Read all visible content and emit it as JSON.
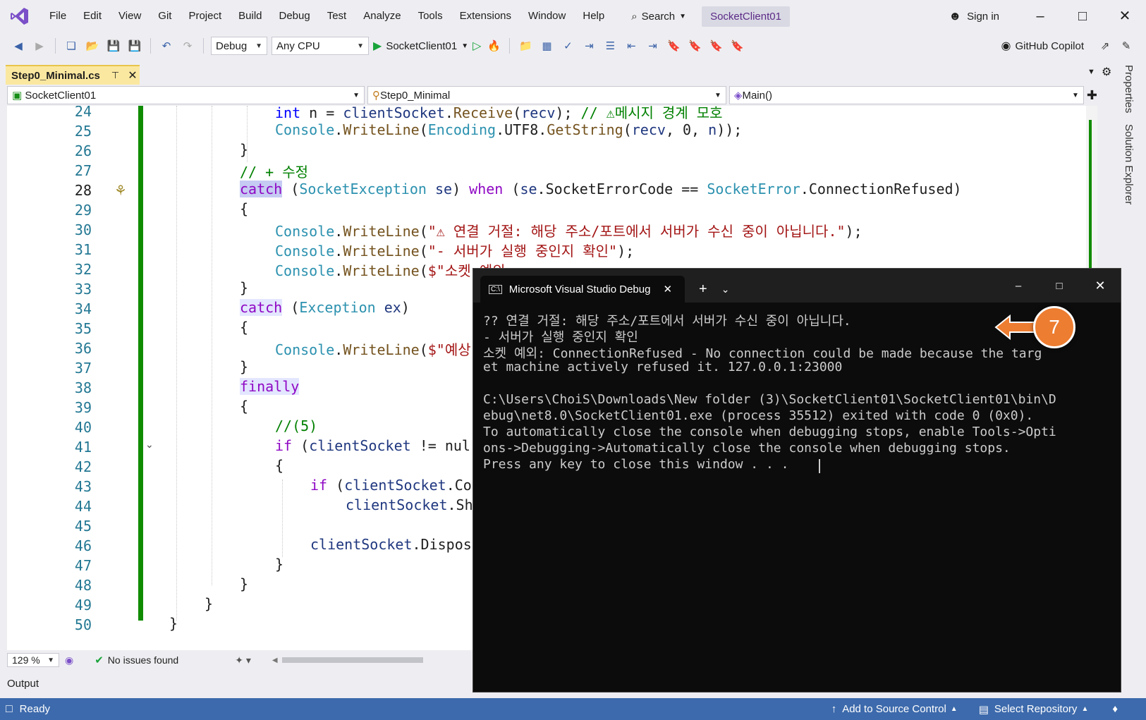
{
  "titlebar": {
    "menu": [
      "File",
      "Edit",
      "View",
      "Git",
      "Project",
      "Build",
      "Debug",
      "Test",
      "Analyze",
      "Tools",
      "Extensions",
      "Window",
      "Help"
    ],
    "search_label": "Search",
    "solution_name": "SocketClient01",
    "sign_in": "Sign in"
  },
  "toolbar": {
    "config": "Debug",
    "platform": "Any CPU",
    "run_target": "SocketClient01",
    "copilot": "GitHub Copilot"
  },
  "doc_tab": {
    "title": "Step0_Minimal.cs"
  },
  "navbar": {
    "project": "SocketClient01",
    "class": "Step0_Minimal",
    "member": "Main()"
  },
  "editor": {
    "line_numbers": [
      "24",
      "25",
      "26",
      "27",
      "28",
      "29",
      "30",
      "31",
      "32",
      "33",
      "34",
      "35",
      "36",
      "37",
      "38",
      "39",
      "40",
      "41",
      "42",
      "43",
      "44",
      "45",
      "46",
      "47",
      "48",
      "49",
      "50"
    ],
    "active_line": "28",
    "code": {
      "l24": [
        "int",
        " n = ",
        "clientSocket",
        ".",
        "Receive",
        "(",
        "recv",
        "); ",
        "// ⚠메시지 경계 모호"
      ],
      "l25": [
        "Console",
        ".",
        "WriteLine",
        "(",
        "Encoding",
        ".UTF8.",
        "GetString",
        "(",
        "recv",
        ", 0, ",
        "n",
        "));"
      ],
      "l26": "}",
      "l27": "// + 수정",
      "l28": [
        "catch",
        " (",
        "SocketException",
        " ",
        "se",
        ") ",
        "when",
        " (",
        "se",
        ".SocketErrorCode == ",
        "SocketError",
        ".ConnectionRefused)"
      ],
      "l29": "{",
      "l30": [
        "Console",
        ".",
        "WriteLine",
        "(",
        "\"⚠ 연결 거절: 해당 주소/포트에서 서버가 수신 중이 아닙니다.\"",
        ");"
      ],
      "l31": [
        "Console",
        ".",
        "WriteLine",
        "(",
        "\"- 서버가 실행 중인지 확인\"",
        ");"
      ],
      "l32": [
        "Console",
        ".",
        "WriteLine",
        "(",
        "$\"소켓 예외"
      ],
      "l33": "}",
      "l34": [
        "catch",
        " (",
        "Exception",
        " ",
        "ex",
        ")"
      ],
      "l35": "{",
      "l36": [
        "Console",
        ".",
        "WriteLine",
        "(",
        "$\"예상"
      ],
      "l37": "}",
      "l38": "finally",
      "l39": "{",
      "l40": "//(5)",
      "l41": [
        "if",
        " (",
        "clientSocket",
        " != nul"
      ],
      "l42": "{",
      "l43": [
        "if",
        " (",
        "clientSocket",
        ".Co"
      ],
      "l44": [
        "clientSocket",
        ".Sh"
      ],
      "l46": [
        "clientSocket",
        ".Dispos"
      ],
      "l47": "}",
      "l48": "}",
      "l49": "}",
      "l50": "}"
    }
  },
  "editor_status": {
    "zoom": "129 %",
    "issues": "No issues found"
  },
  "output_label": "Output",
  "statusbar": {
    "ready": "Ready",
    "source_control": "Add to Source Control",
    "repository": "Select Repository"
  },
  "side_tabs": [
    "Properties",
    "Solution Explorer"
  ],
  "console": {
    "tab_title": "Microsoft Visual Studio Debug",
    "lines": [
      "?? 연결 거절: 해당 주소/포트에서 서버가 수신 중이 아닙니다.",
      "- 서버가 실행 중인지 확인",
      "소켓 예외: ConnectionRefused - No connection could be made because the targ",
      "et machine actively refused it. 127.0.0.1:23000",
      "",
      "C:\\Users\\ChoiS\\Downloads\\New folder (3)\\SocketClient01\\SocketClient01\\bin\\D",
      "ebug\\net8.0\\SocketClient01.exe (process 35512) exited with code 0 (0x0).",
      "To automatically close the console when debugging stops, enable Tools->Opti",
      "ons->Debugging->Automatically close the console when debugging stops.",
      "Press any key to close this window . . ."
    ]
  },
  "callout": {
    "number": "7",
    "color": "#ed7d31"
  }
}
